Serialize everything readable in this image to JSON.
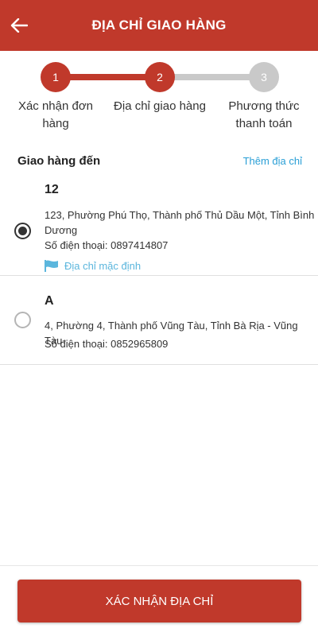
{
  "header": {
    "title": "ĐỊA CHỈ GIAO HÀNG",
    "back_icon": "arrow-left-icon"
  },
  "stepper": {
    "current_step": 2,
    "steps": [
      {
        "number": "1",
        "label": "Xác nhận đơn hàng",
        "state": "done"
      },
      {
        "number": "2",
        "label": "Địa chỉ giao hàng",
        "state": "active"
      },
      {
        "number": "3",
        "label": "Phương thức thanh toán",
        "state": "pending"
      }
    ]
  },
  "shipping": {
    "title": "Giao hàng đến",
    "add_label": "Thêm địa chỉ",
    "addresses": [
      {
        "name": "12",
        "address": "123, Phường Phú Thọ, Thành phố Thủ Dầu Một, Tỉnh Bình Dương",
        "phone": "Số điện thoại: 0897414807",
        "default_label": "Địa chỉ mặc định",
        "selected": true
      },
      {
        "name": "A",
        "address": "4, Phường 4, Thành phố Vũng Tàu, Tỉnh Bà Rịa - Vũng Tàu",
        "phone": "Số điện thoại: 0852965809",
        "selected": false
      }
    ]
  },
  "footer": {
    "confirm_label": "XÁC NHẬN ĐỊA CHỈ"
  },
  "colors": {
    "primary": "#c0392b",
    "inactive": "#c9c9c9",
    "link": "#2a9fd6",
    "default_tag": "#5bb6dd"
  }
}
